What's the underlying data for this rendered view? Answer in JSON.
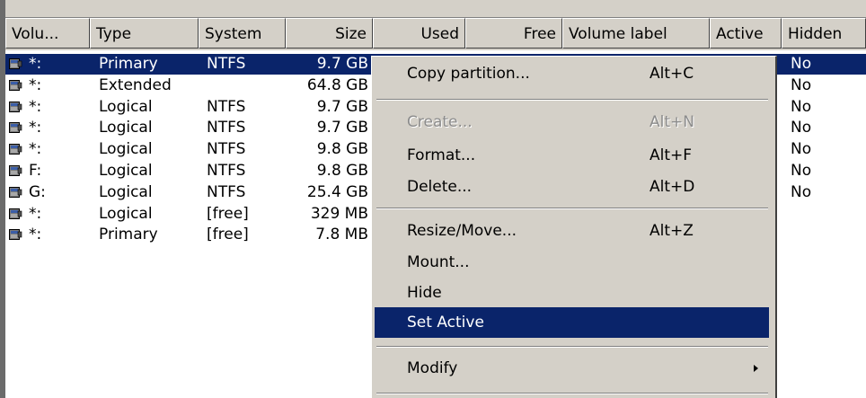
{
  "columns": [
    "Volu...",
    "Type",
    "System",
    "Size",
    "Used",
    "Free",
    "Volume label",
    "Active",
    "Hidden"
  ],
  "rows": [
    {
      "volume": "*:",
      "type": "Primary",
      "system": "NTFS",
      "size": "9.7 GB",
      "hidden": "No",
      "selected": true
    },
    {
      "volume": "*:",
      "type": "Extended",
      "system": "",
      "size": "64.8 GB",
      "hidden": "No"
    },
    {
      "volume": "*:",
      "type": "Logical",
      "system": "NTFS",
      "size": "9.7 GB",
      "hidden": "No"
    },
    {
      "volume": "*:",
      "type": "Logical",
      "system": "NTFS",
      "size": "9.7 GB",
      "hidden": "No"
    },
    {
      "volume": "*:",
      "type": "Logical",
      "system": "NTFS",
      "size": "9.8 GB",
      "hidden": "No"
    },
    {
      "volume": "F:",
      "type": "Logical",
      "system": "NTFS",
      "size": "9.8 GB",
      "hidden": "No"
    },
    {
      "volume": "G:",
      "type": "Logical",
      "system": "NTFS",
      "size": "25.4 GB",
      "hidden": "No"
    },
    {
      "volume": "*:",
      "type": "Logical",
      "system": "[free]",
      "size": "329 MB",
      "hidden": ""
    },
    {
      "volume": "*:",
      "type": "Primary",
      "system": "[free]",
      "size": "7.8 MB",
      "hidden": ""
    }
  ],
  "context_menu": {
    "copy": {
      "label": "Copy partition...",
      "shortcut": "Alt+C"
    },
    "create": {
      "label": "Create...",
      "shortcut": "Alt+N",
      "disabled": true
    },
    "format": {
      "label": "Format...",
      "shortcut": "Alt+F"
    },
    "delete": {
      "label": "Delete...",
      "shortcut": "Alt+D"
    },
    "resize": {
      "label": "Resize/Move...",
      "shortcut": "Alt+Z"
    },
    "mount": {
      "label": "Mount..."
    },
    "hide": {
      "label": "Hide"
    },
    "set_active": {
      "label": "Set Active",
      "highlighted": true
    },
    "modify": {
      "label": "Modify"
    }
  },
  "colors": {
    "selection": "#0a246a",
    "chrome": "#d4d0c8"
  },
  "icons": {
    "disk": "disk-drive-icon",
    "submenu": "chevron-right-icon"
  }
}
